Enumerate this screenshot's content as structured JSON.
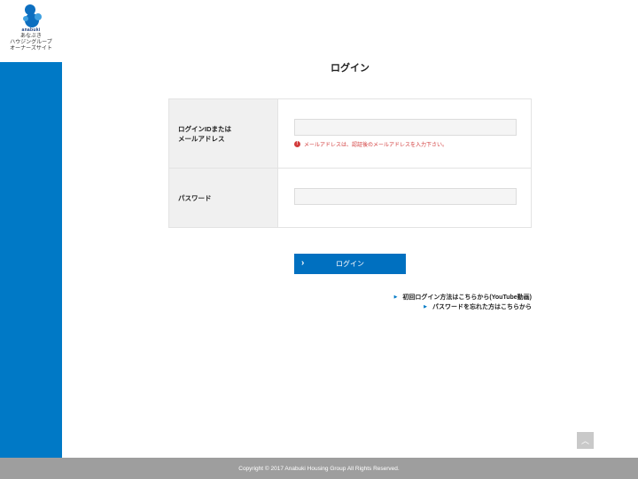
{
  "logo": {
    "brand": "anabuki",
    "line1": "あなぶき",
    "line2": "ハウジングループ",
    "line3": "オーナーズサイト"
  },
  "page": {
    "title": "ログイン"
  },
  "form": {
    "login_id_label": "ログインIDまたは\nメールアドレス",
    "login_id_value": "",
    "login_id_error": "メールアドレスは、認証後のメールアドレスを入力下さい。",
    "password_label": "パスワード",
    "password_value": ""
  },
  "buttons": {
    "login": "ログイン"
  },
  "links": {
    "first_login": "初回ログイン方法はこちらから(YouTube動画)",
    "forgot_password": "パスワードを忘れた方はこちらから"
  },
  "footer": {
    "copyright": "Copyright © 2017 Anabuki Housing Group All Rights Reserved."
  },
  "colors": {
    "accent": "#0079c6",
    "error": "#d23c3c",
    "footer": "#9e9e9e"
  }
}
